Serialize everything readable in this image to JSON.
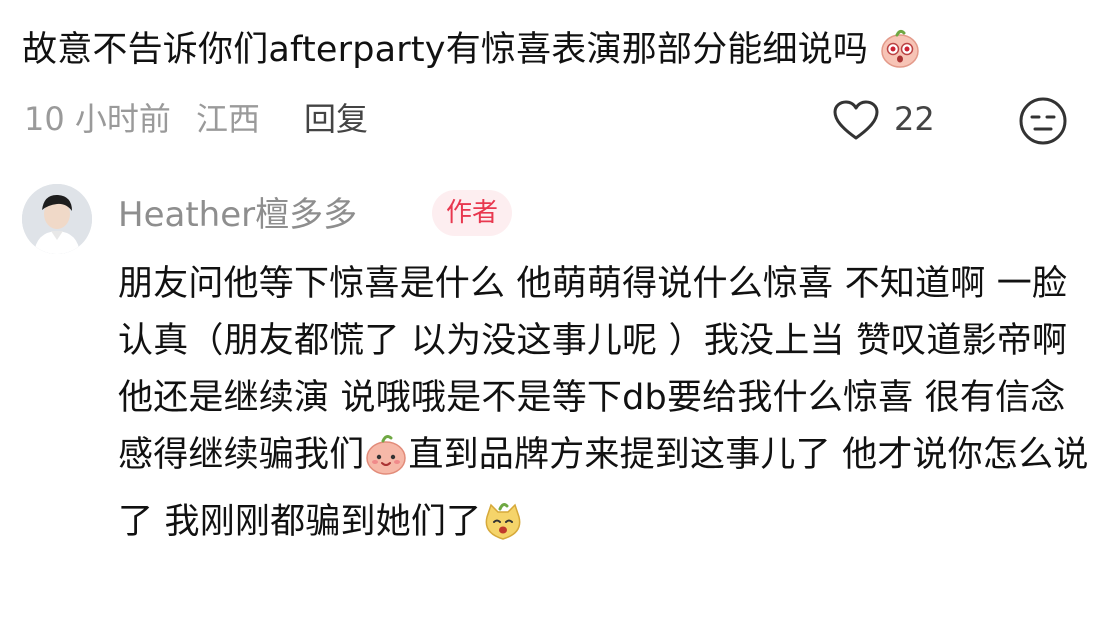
{
  "comment": {
    "text": "故意不告诉你们afterparty有惊喜表演那部分能细说吗",
    "time": "10 小时前",
    "location": "江西",
    "reply_label": "回复",
    "like_count": "22"
  },
  "reply": {
    "author": "Heather檀多多",
    "badge": "作者",
    "text_part1": "朋友问他等下惊喜是什么 他萌萌得说什么惊喜 不知道啊 一脸认真（朋友都慌了 以为没这事儿呢 ）我没上当 赞叹道影帝啊 他还是继续演 说哦哦是不是等下db要给我什么惊喜 很有信念感得继续骗我们",
    "text_part2": "直到品牌方来提到这事儿了 他才说你怎么说了 我刚刚都骗到她们了"
  },
  "icons": {
    "emoji_1": "surprised-peach-emoji",
    "emoji_2": "smiling-peach-emoji",
    "emoji_3": "happy-cat-emoji",
    "like": "heart-outline-icon",
    "dislike": "neutral-face-icon"
  },
  "colors": {
    "accent": "#e8384f",
    "badge_bg": "#fdeef0",
    "muted": "#9a9a9a",
    "text": "#111111"
  }
}
